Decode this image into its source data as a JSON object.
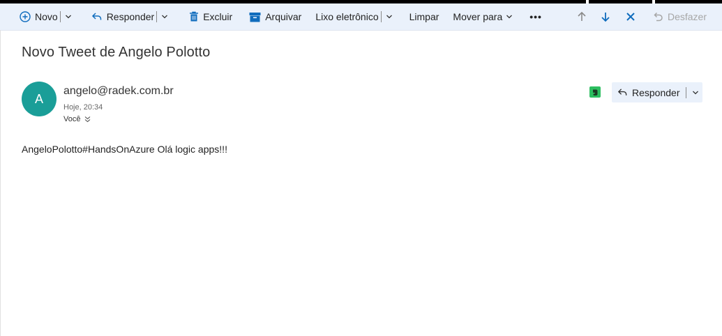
{
  "toolbar": {
    "new_label": "Novo",
    "reply_label": "Responder",
    "delete_label": "Excluir",
    "archive_label": "Arquivar",
    "junk_label": "Lixo eletrônico",
    "sweep_label": "Limpar",
    "move_label": "Mover para",
    "more_label": "•••",
    "undo_label": "Desfazer"
  },
  "message": {
    "subject": "Novo Tweet de Angelo Polotto",
    "avatar_initial": "A",
    "avatar_color": "#1a9e98",
    "sender": "angelo@radek.com.br",
    "date": "Hoje, 20:34",
    "recipient": "Você",
    "reply_label": "Responder",
    "body": "AngeloPolotto#HandsOnAzure Olá logic apps!!!"
  },
  "colors": {
    "accent": "#0f6cbd",
    "toolbar_bg": "#eaf1fb",
    "evernote": "#2dbe60"
  },
  "icons": [
    "plus-circle-icon",
    "reply-icon",
    "trash-icon",
    "archive-icon",
    "chevron-down-icon",
    "more-icon",
    "arrow-up-icon",
    "arrow-down-icon",
    "close-icon",
    "undo-icon",
    "evernote-icon",
    "double-chevron-down-icon"
  ]
}
